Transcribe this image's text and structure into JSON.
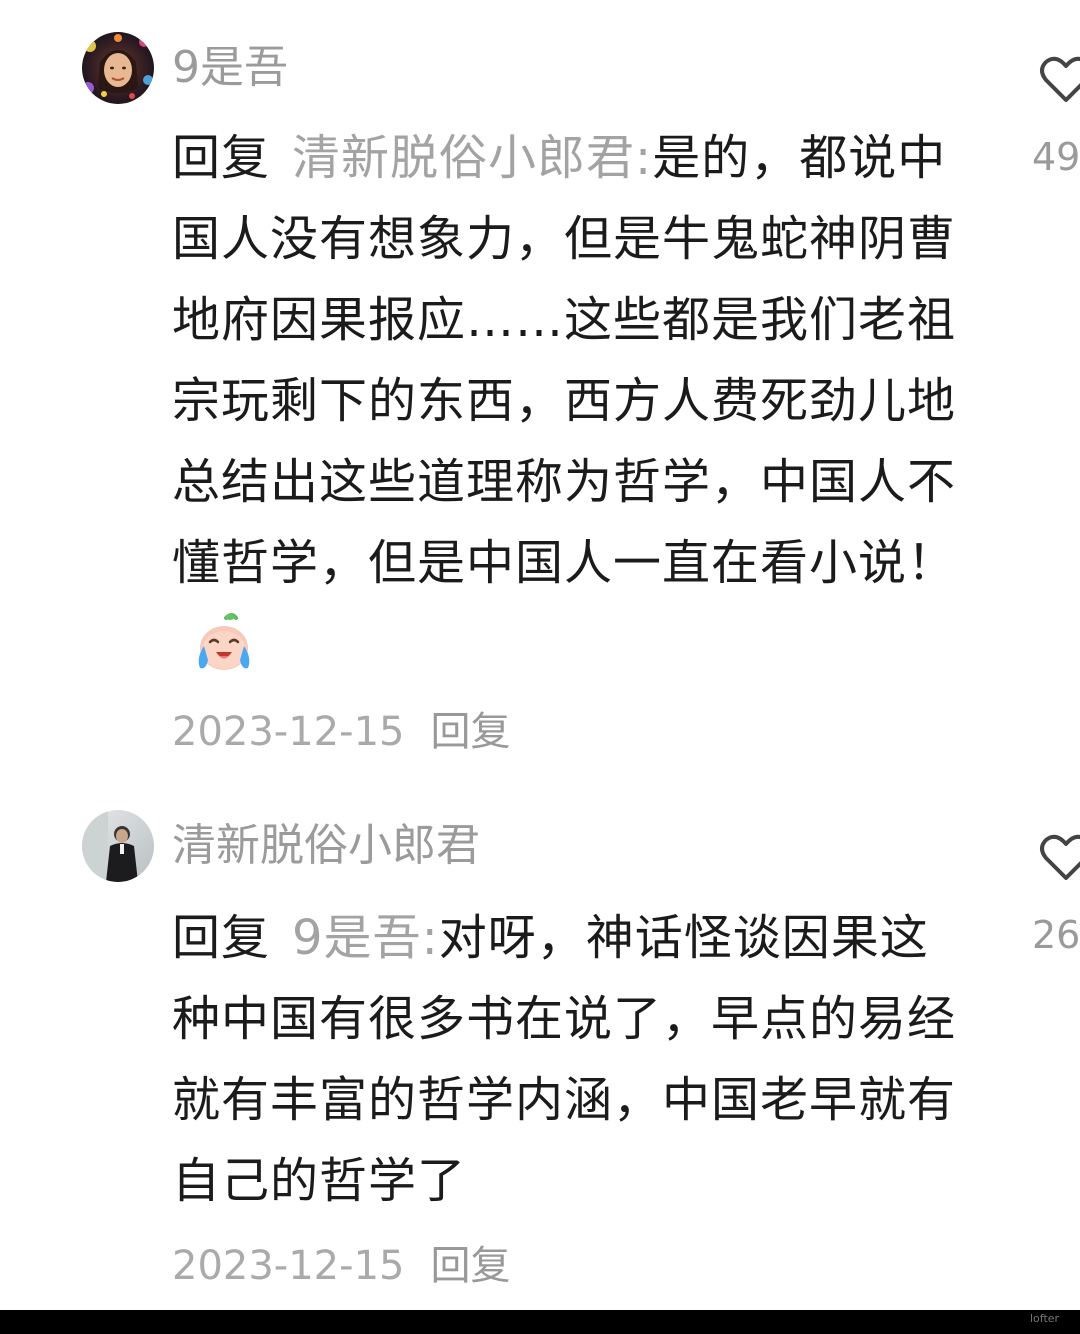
{
  "comments": [
    {
      "username": "9是吾",
      "reply_prefix": "回复",
      "reply_target": "清新脱俗小郎君",
      "colon": ":",
      "text": "是的，都说中国人没有想象力，但是牛鬼蛇神阴曹地府因果报应……这些都是我们老祖宗玩剩下的东西，西方人费死劲儿地总结出这些道理称为哲学，中国人不懂哲学，但是中国人一直在看小说！",
      "emoji": "crying-laughing-emoji",
      "date": "2023-12-15",
      "reply_button": "回复",
      "like_count": "49"
    },
    {
      "username": "清新脱俗小郎君",
      "reply_prefix": "回复",
      "reply_target": "9是吾",
      "colon": ":",
      "text": "对呀，神话怪谈因果这种中国有很多书在说了，早点的易经就有丰富的哲学内涵，中国老早就有自己的哲学了",
      "date": "2023-12-15",
      "reply_button": "回复",
      "like_count": "26"
    }
  ],
  "watermark": "lofter",
  "icons": {
    "like": "heart-outline-icon"
  },
  "colors": {
    "text": "#1b1b1b",
    "muted": "#a3a3a3"
  }
}
